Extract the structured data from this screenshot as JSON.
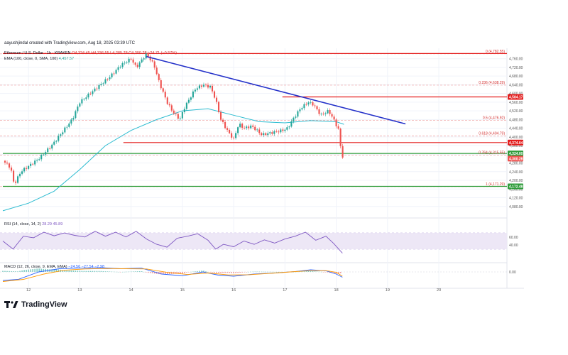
{
  "attribution": "aayushjindal created with TradingView.com, Aug 18, 2025 03:39 UTC",
  "brand": "TradingView",
  "header": {
    "symbol": "Ethereum / U.S. Dollar · 1h · KRAKEN",
    "ohlc": "O4,324.45 H4,336.55 L4,285.78 C4,300.28 −24.71 (−0.57%)",
    "ema_label": "EMA (100, close, 0, SMA, 100)",
    "ema_value": "4,457.57"
  },
  "rsi_header": "RSI (14, close, 14, 2)",
  "rsi_values": "28.29 45.89",
  "macd_header": "MACD (12, 26, close, 9, EMA, EMA)",
  "macd_values": "−24.56 −27.54 −2.98",
  "colors": {
    "up": "#26a69a",
    "down": "#ef5350",
    "ema": "#2bbbd0",
    "trendline": "#2431c9",
    "resistance": "#e31d1d",
    "support": "#2e9c3a",
    "rsi_line": "#7e57c2",
    "rsi_band": "#ede7f6",
    "macd_line": "#2962ff",
    "signal_line": "#ff9800"
  },
  "chart_data": {
    "type": "candlestick",
    "timeframe": "1h",
    "xlim": [
      11.5,
      21.3
    ],
    "ylim": [
      4040,
      4795
    ],
    "x_ticks": [
      12,
      13,
      14,
      15,
      16,
      17,
      18,
      19,
      20
    ],
    "x_tick_labels": [
      "12",
      "13",
      "14",
      "15",
      "16",
      "17",
      "18",
      "19",
      "20"
    ],
    "y_ticks": [
      4080,
      4120,
      4160,
      4200,
      4240,
      4280,
      4320,
      4360,
      4400,
      4440,
      4480,
      4520,
      4560,
      4600,
      4640,
      4680,
      4720,
      4760
    ],
    "y_tick_labels": [
      "4,080.00",
      "4,120.00",
      "4,160.00",
      "4,200.00",
      "4,240.00",
      "4,280.00",
      "4,320.00",
      "4,360.00",
      "4,400.00",
      "4,440.00",
      "4,480.00",
      "4,520.00",
      "4,560.00",
      "4,600.00",
      "4,640.00",
      "4,680.00",
      "4,720.00",
      "4,760.00"
    ],
    "price_path": [
      [
        11.5,
        4290
      ],
      [
        11.65,
        4260
      ],
      [
        11.72,
        4180
      ],
      [
        11.85,
        4240
      ],
      [
        12.0,
        4265
      ],
      [
        12.2,
        4300
      ],
      [
        12.45,
        4360
      ],
      [
        12.65,
        4420
      ],
      [
        12.85,
        4480
      ],
      [
        13.0,
        4560
      ],
      [
        13.2,
        4600
      ],
      [
        13.4,
        4640
      ],
      [
        13.6,
        4680
      ],
      [
        13.8,
        4730
      ],
      [
        14.0,
        4760
      ],
      [
        14.1,
        4720
      ],
      [
        14.3,
        4783
      ],
      [
        14.45,
        4730
      ],
      [
        14.55,
        4650
      ],
      [
        14.7,
        4560
      ],
      [
        14.8,
        4520
      ],
      [
        14.95,
        4480
      ],
      [
        15.05,
        4540
      ],
      [
        15.25,
        4620
      ],
      [
        15.4,
        4640
      ],
      [
        15.55,
        4630
      ],
      [
        15.65,
        4570
      ],
      [
        15.75,
        4480
      ],
      [
        15.9,
        4420
      ],
      [
        16.0,
        4390
      ],
      [
        16.1,
        4460
      ],
      [
        16.2,
        4440
      ],
      [
        16.35,
        4450
      ],
      [
        16.55,
        4410
      ],
      [
        16.75,
        4420
      ],
      [
        16.95,
        4430
      ],
      [
        17.05,
        4440
      ],
      [
        17.15,
        4480
      ],
      [
        17.3,
        4530
      ],
      [
        17.45,
        4560
      ],
      [
        17.55,
        4550
      ],
      [
        17.7,
        4500
      ],
      [
        17.85,
        4520
      ],
      [
        17.95,
        4480
      ],
      [
        18.05,
        4430
      ],
      [
        18.1,
        4320
      ],
      [
        18.15,
        4300
      ]
    ],
    "ema_100": [
      [
        11.5,
        4060
      ],
      [
        12.0,
        4095
      ],
      [
        12.5,
        4150
      ],
      [
        13.0,
        4250
      ],
      [
        13.5,
        4360
      ],
      [
        14.0,
        4430
      ],
      [
        14.5,
        4480
      ],
      [
        15.0,
        4520
      ],
      [
        15.5,
        4530
      ],
      [
        16.0,
        4500
      ],
      [
        16.5,
        4470
      ],
      [
        17.0,
        4465
      ],
      [
        17.5,
        4475
      ],
      [
        18.0,
        4470
      ],
      [
        18.15,
        4458
      ]
    ],
    "trendline": {
      "start": [
        14.3,
        4770
      ],
      "end": [
        19.35,
        4460
      ]
    },
    "resistance_lines": [
      {
        "price": 4784,
        "from": 11.5
      },
      {
        "price": 4584.17,
        "from": 16.95
      },
      {
        "price": 4374.04,
        "from": 13.85
      }
    ],
    "support_lines": [
      {
        "price": 4324,
        "from": 11.5
      },
      {
        "price": 4172.48,
        "from": 11.5
      }
    ],
    "fib_levels": [
      {
        "ratio": "0",
        "price": 4782.55,
        "label": "0 (4,782.55)"
      },
      {
        "ratio": "0.236",
        "price": 4638.29,
        "label": "0.236 (4,638.29)"
      },
      {
        "ratio": "0.5",
        "price": 4476.92,
        "label": "0.5 (4,476.92)"
      },
      {
        "ratio": "0.618",
        "price": 4404.79,
        "label": "0.618 (4,404.79)"
      },
      {
        "ratio": "0.764",
        "price": 4315.55,
        "label": "0.764 (4,315.55)"
      },
      {
        "ratio": "1",
        "price": 4171.29,
        "label": "1 (4,171.29)"
      }
    ],
    "price_labels": [
      {
        "text": "4,584.17",
        "price": 4584.17,
        "color": "#e31d1d"
      },
      {
        "text": "4,374.04",
        "price": 4374.04,
        "color": "#e31d1d"
      },
      {
        "text": "4,324.00",
        "price": 4324,
        "color": "#2e9c3a"
      },
      {
        "text": "4,300.28",
        "price": 4300.28,
        "color": "#ef5350"
      },
      {
        "text": "4,172.48",
        "price": 4172.48,
        "color": "#2e9c3a"
      }
    ],
    "rsi": {
      "ylim": [
        0,
        100
      ],
      "bands": [
        30,
        70
      ],
      "y_tick_labels": [
        "60.00",
        "40.00"
      ],
      "y_ticks": [
        60,
        40
      ],
      "path": [
        [
          11.5,
          50
        ],
        [
          11.7,
          30
        ],
        [
          11.9,
          62
        ],
        [
          12.1,
          58
        ],
        [
          12.3,
          72
        ],
        [
          12.5,
          63
        ],
        [
          12.7,
          70
        ],
        [
          12.9,
          64
        ],
        [
          13.1,
          60
        ],
        [
          13.3,
          74
        ],
        [
          13.5,
          62
        ],
        [
          13.7,
          72
        ],
        [
          13.9,
          60
        ],
        [
          14.1,
          74
        ],
        [
          14.3,
          55
        ],
        [
          14.5,
          42
        ],
        [
          14.7,
          35
        ],
        [
          14.9,
          57
        ],
        [
          15.1,
          62
        ],
        [
          15.3,
          68
        ],
        [
          15.5,
          52
        ],
        [
          15.65,
          30
        ],
        [
          15.8,
          42
        ],
        [
          16.0,
          36
        ],
        [
          16.2,
          50
        ],
        [
          16.4,
          42
        ],
        [
          16.6,
          53
        ],
        [
          16.8,
          45
        ],
        [
          17.0,
          55
        ],
        [
          17.2,
          62
        ],
        [
          17.4,
          72
        ],
        [
          17.6,
          52
        ],
        [
          17.8,
          62
        ],
        [
          17.95,
          44
        ],
        [
          18.05,
          30
        ],
        [
          18.12,
          20
        ]
      ]
    },
    "macd": {
      "ylim": [
        -70,
        40
      ],
      "y_tick_labels": [
        "0.00"
      ],
      "y_ticks": [
        0
      ],
      "macd_line": [
        [
          11.5,
          -40
        ],
        [
          11.8,
          -35
        ],
        [
          12.2,
          0
        ],
        [
          12.6,
          15
        ],
        [
          13.0,
          18
        ],
        [
          13.4,
          20
        ],
        [
          13.8,
          15
        ],
        [
          14.2,
          18
        ],
        [
          14.6,
          -10
        ],
        [
          15.0,
          -18
        ],
        [
          15.4,
          0
        ],
        [
          15.7,
          -15
        ],
        [
          16.0,
          -20
        ],
        [
          16.4,
          -10
        ],
        [
          16.8,
          -5
        ],
        [
          17.2,
          2
        ],
        [
          17.5,
          10
        ],
        [
          17.8,
          5
        ],
        [
          18.0,
          -10
        ],
        [
          18.12,
          -25
        ]
      ],
      "signal_line": [
        [
          11.5,
          -45
        ],
        [
          11.9,
          -35
        ],
        [
          12.3,
          -10
        ],
        [
          12.7,
          8
        ],
        [
          13.1,
          14
        ],
        [
          13.5,
          16
        ],
        [
          13.9,
          15
        ],
        [
          14.3,
          14
        ],
        [
          14.7,
          -2
        ],
        [
          15.1,
          -12
        ],
        [
          15.5,
          -5
        ],
        [
          15.9,
          -14
        ],
        [
          16.3,
          -13
        ],
        [
          16.7,
          -7
        ],
        [
          17.1,
          0
        ],
        [
          17.5,
          6
        ],
        [
          17.8,
          6
        ],
        [
          18.0,
          -2
        ],
        [
          18.12,
          -20
        ]
      ]
    }
  }
}
